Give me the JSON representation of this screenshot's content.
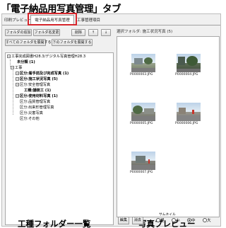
{
  "caption": {
    "text": "「電子納品用写真管理」タブ"
  },
  "tabs": [
    {
      "label": "印刷プレビュー"
    },
    {
      "label": "電子納品用写真管理",
      "active": true
    },
    {
      "label": "工事管理項目"
    }
  ],
  "toolbar": {
    "add_folder": "フォルダの追加",
    "rename_folder": "フォルダ名変更",
    "delete": "削除",
    "move_up": "↑",
    "move_down": "↓",
    "expand_all": "すべてのフォルダを展開する",
    "expand_below": "下のフォルダを展開する"
  },
  "tree": {
    "items": [
      {
        "label": "工事完成図書H28.3/デジタル写真管理H28.3",
        "toggle": "−"
      },
      {
        "label": "未分類 (1)",
        "toggle": ""
      },
      {
        "label": "工事",
        "toggle": "−"
      },
      {
        "label": "区分:着手前及び完成写真 (1)",
        "toggle": "−"
      },
      {
        "label": "区分:施工状況写真 (5)",
        "toggle": "−",
        "selected": true
      },
      {
        "label": "区分:安全管理写真",
        "toggle": "−"
      },
      {
        "label": "工種:舗装工 (1)",
        "toggle": ""
      },
      {
        "label": "区分:使用材料写真 (1)",
        "toggle": "−"
      },
      {
        "label": "区分:品質管理写真",
        "toggle": ""
      },
      {
        "label": "区分:出来形管理写真",
        "toggle": ""
      },
      {
        "label": "区分:災害写真",
        "toggle": ""
      },
      {
        "label": "区分:その他",
        "toggle": ""
      }
    ]
  },
  "photos": {
    "folder_label": "選択フォルダ: 施工状況写真 (5)",
    "files": [
      {
        "name": "P0000003.JPG"
      },
      {
        "name": "P0000004.JPG"
      },
      {
        "name": "P0000005.JPG"
      },
      {
        "name": "P0000006.JPG"
      },
      {
        "name": "P0000007.JPG"
      }
    ]
  },
  "annotations": {
    "preview": "写真プレビュー",
    "tree": "工種フォルダー一覧"
  },
  "bottom": {
    "edit": "編集",
    "clear": "消去",
    "thumb_size_label": "サムネイル",
    "sizes": [
      {
        "label": "極",
        "selected": false
      },
      {
        "label": "小",
        "selected": false
      },
      {
        "label": "中",
        "selected": true
      },
      {
        "label": "大",
        "selected": false
      }
    ]
  },
  "colors": {
    "highlight": "#d6262c"
  }
}
